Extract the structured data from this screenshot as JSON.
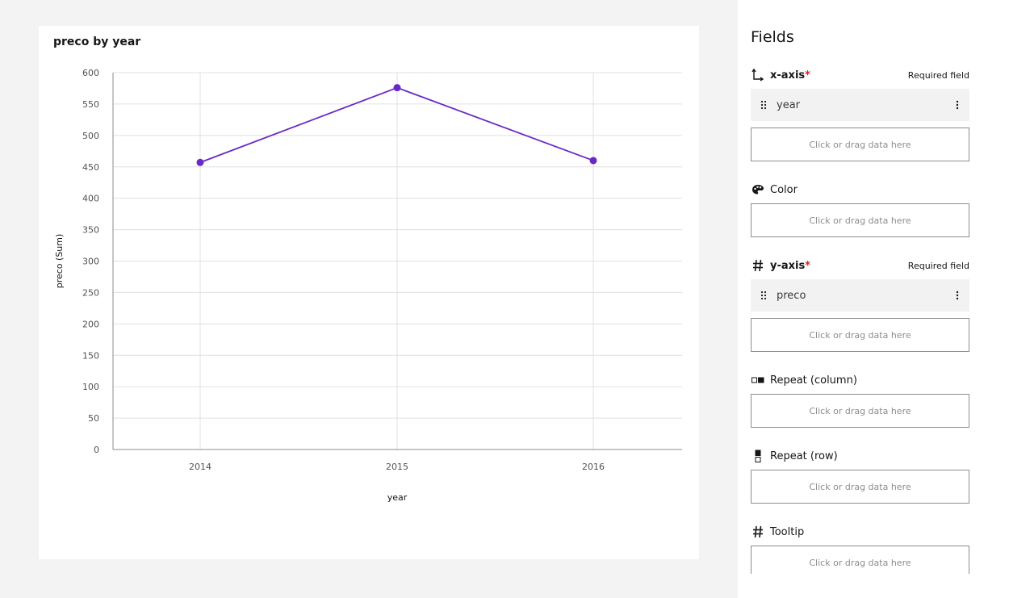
{
  "chart": {
    "title": "preco by year"
  },
  "chart_data": {
    "type": "line",
    "title": "preco by year",
    "xlabel": "year",
    "ylabel": "preco (Sum)",
    "categories": [
      "2014",
      "2015",
      "2016"
    ],
    "series": [
      {
        "values": [
          457,
          576,
          460
        ]
      }
    ],
    "ylim": [
      0,
      600
    ],
    "yticks": [
      "0",
      "50",
      "100",
      "150",
      "200",
      "250",
      "300",
      "350",
      "400",
      "450",
      "500",
      "550",
      "600"
    ],
    "grid": true,
    "line_color": "#6929c4"
  },
  "panel": {
    "title": "Fields",
    "drop_placeholder": "Click or drag data here",
    "sections": {
      "x_axis": {
        "label": "x-axis",
        "star": "*",
        "note": "Required field",
        "field": "year",
        "icon": "axis-arrow-icon"
      },
      "color": {
        "label": "Color",
        "icon": "palette-icon"
      },
      "y_axis": {
        "label": "y-axis",
        "star": "*",
        "note": "Required field",
        "field": "preco",
        "icon": "hash-icon"
      },
      "repeat_column": {
        "label": "Repeat (column)",
        "icon": "repeat-column-icon"
      },
      "repeat_row": {
        "label": "Repeat (row)",
        "icon": "repeat-row-icon"
      },
      "tooltip": {
        "label": "Tooltip",
        "icon": "hash-icon"
      }
    }
  }
}
